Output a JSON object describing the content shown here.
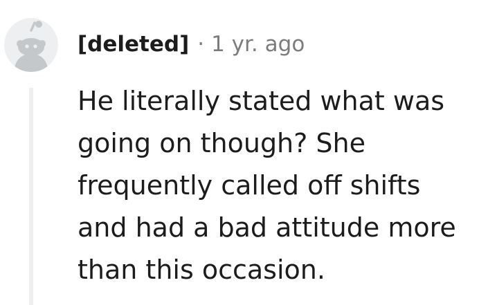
{
  "comment": {
    "author": "[deleted]",
    "separator": "·",
    "timestamp": "1 yr. ago",
    "body": "He literally stated what was\ngoing on though? She\nfrequently called off shifts\nand had a bad attitude more\nthan this occasion."
  },
  "avatar": {
    "icon": "reddit-snoo-icon",
    "background_color": "#edeff1",
    "foreground_color": "#c4c8cb"
  },
  "colors": {
    "text": "#1c1c1c",
    "meta": "#7c7c7c",
    "thread_line": "#edeff1"
  }
}
